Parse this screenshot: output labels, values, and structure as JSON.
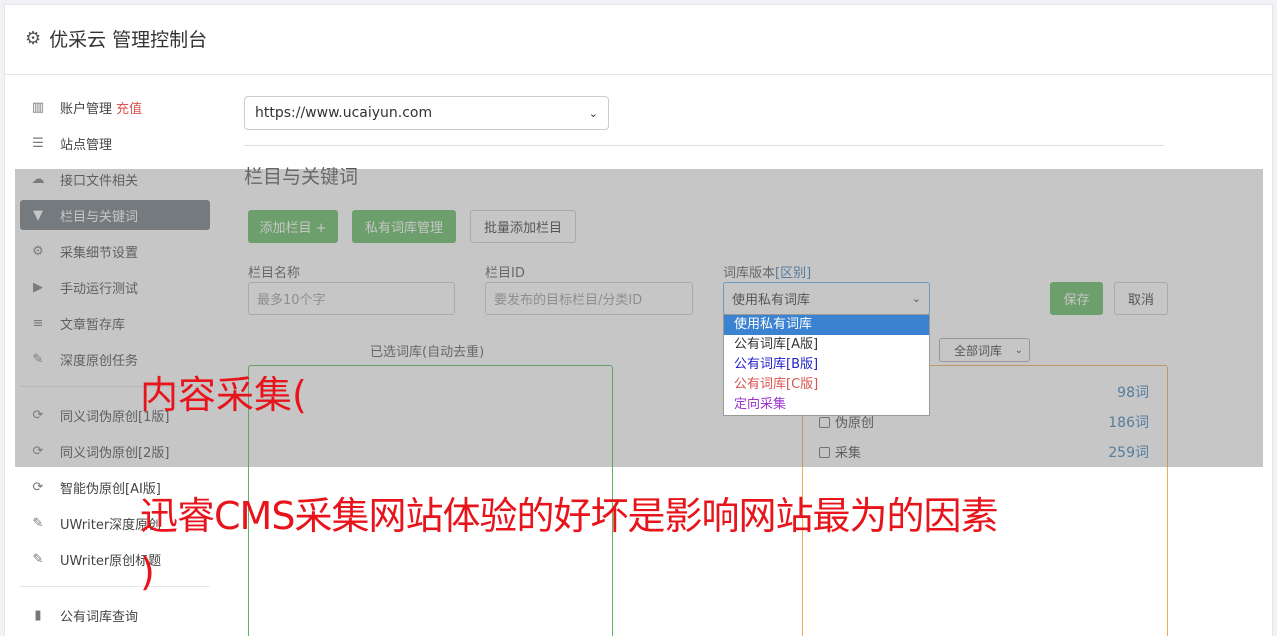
{
  "header": {
    "title": "优采云 管理控制台"
  },
  "sidebar": {
    "items": [
      {
        "icon": "bar-chart-icon",
        "glyph": "▥",
        "label": "账户管理",
        "tag": "充值"
      },
      {
        "icon": "server-icon",
        "glyph": "☰",
        "label": "站点管理"
      },
      {
        "icon": "cloud-upload-icon",
        "glyph": "☁",
        "label": "接口文件相关"
      },
      {
        "icon": "filter-icon",
        "glyph": "▼",
        "label": "栏目与关键词",
        "active": true
      },
      {
        "icon": "gears-icon",
        "glyph": "⚙",
        "label": "采集细节设置"
      },
      {
        "icon": "play-circle-icon",
        "glyph": "▶",
        "label": "手动运行测试"
      },
      {
        "icon": "database-icon",
        "glyph": "≡",
        "label": "文章暂存库"
      },
      {
        "icon": "edit-icon",
        "glyph": "✎",
        "label": "深度原创任务"
      }
    ],
    "items2": [
      {
        "icon": "refresh-icon",
        "glyph": "⟳",
        "label": "同义词伪原创[1版]"
      },
      {
        "icon": "refresh-icon",
        "glyph": "⟳",
        "label": "同义词伪原创[2版]"
      },
      {
        "icon": "refresh-icon",
        "glyph": "⟳",
        "label": "智能伪原创[AI版]"
      },
      {
        "icon": "edit-icon",
        "glyph": "✎",
        "label": "UWriter深度原创"
      },
      {
        "icon": "edit-icon",
        "glyph": "✎",
        "label": "UWriter原创标题"
      }
    ],
    "items3": [
      {
        "icon": "book-icon",
        "glyph": "▮",
        "label": "公有词库查询"
      }
    ]
  },
  "main": {
    "site_select": "https://www.ucaiyun.com",
    "section_title": "栏目与关键词",
    "buttons": {
      "add_column": "添加栏目 +",
      "private_lib": "私有词库管理",
      "batch_add": "批量添加栏目",
      "save": "保存",
      "cancel": "取消"
    },
    "fields": {
      "name_label": "栏目名称",
      "name_placeholder": "最多10个字",
      "id_label": "栏目ID",
      "id_placeholder": "要发布的目标栏目/分类ID",
      "version_label": "词库版本",
      "version_link": "[区别]",
      "version_value": "使用私有词库"
    },
    "version_options": [
      {
        "label": "使用私有词库",
        "color": "#ffffff"
      },
      {
        "label": "公有词库[A版]",
        "color": "#333333"
      },
      {
        "label": "公有词库[B版]",
        "color": "#2222cc"
      },
      {
        "label": "公有词库[C版]",
        "color": "#d9534f"
      },
      {
        "label": "定向采集",
        "color": "#9933cc"
      }
    ],
    "selected_caption": "已选词库(自动去重)",
    "lib_filter": "全部词库",
    "libs": [
      {
        "label": "",
        "count": "98词"
      },
      {
        "label": "伪原创",
        "count": "186词"
      },
      {
        "label": "采集",
        "count": "259词"
      }
    ]
  },
  "watermark": {
    "line1": "内容采集(",
    "line2": "迅睿CMS采集网站体验的好坏是影响网站最为的因素",
    "line3": ")"
  }
}
